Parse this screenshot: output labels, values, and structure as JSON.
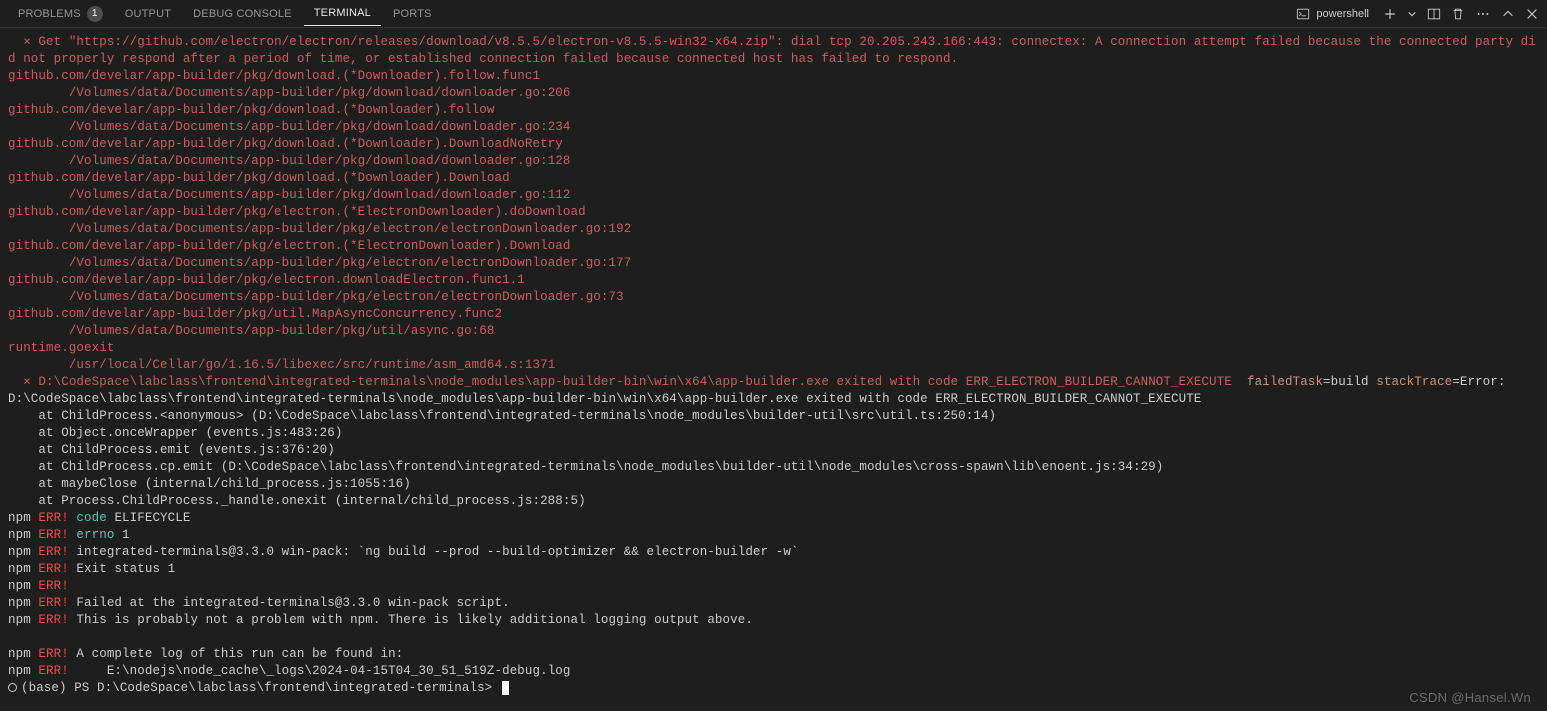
{
  "panel": {
    "tabs": {
      "problems": "PROBLEMS",
      "problemsCount": "1",
      "output": "OUTPUT",
      "debugConsole": "DEBUG CONSOLE",
      "terminal": "TERMINAL",
      "ports": "PORTS"
    },
    "shell": "powershell"
  },
  "term": {
    "errHead": "  ⨯ Get \"https://github.com/electron/electron/releases/download/v8.5.5/electron-v8.5.5-win32-x64.zip\": dial tcp 20.205.243.166:443: connectex: A connection attempt failed because the connected party did not properly respond after a period of time, or established connection failed because connected host has failed to respond.",
    "stackRed": [
      "github.com/develar/app-builder/pkg/download.(*Downloader).follow.func1",
      "        /Volumes/data/Documents/app-builder/pkg/download/downloader.go:206",
      "github.com/develar/app-builder/pkg/download.(*Downloader).follow",
      "        /Volumes/data/Documents/app-builder/pkg/download/downloader.go:234",
      "github.com/develar/app-builder/pkg/download.(*Downloader).DownloadNoRetry",
      "        /Volumes/data/Documents/app-builder/pkg/download/downloader.go:128",
      "github.com/develar/app-builder/pkg/download.(*Downloader).Download",
      "        /Volumes/data/Documents/app-builder/pkg/download/downloader.go:112",
      "github.com/develar/app-builder/pkg/electron.(*ElectronDownloader).doDownload",
      "        /Volumes/data/Documents/app-builder/pkg/electron/electronDownloader.go:192",
      "github.com/develar/app-builder/pkg/electron.(*ElectronDownloader).Download",
      "        /Volumes/data/Documents/app-builder/pkg/electron/electronDownloader.go:177",
      "github.com/develar/app-builder/pkg/electron.downloadElectron.func1.1",
      "        /Volumes/data/Documents/app-builder/pkg/electron/electronDownloader.go:73",
      "github.com/develar/app-builder/pkg/util.MapAsyncConcurrency.func2",
      "        /Volumes/data/Documents/app-builder/pkg/util/async.go:68",
      "runtime.goexit",
      "        /usr/local/Cellar/go/1.16.5/libexec/src/runtime/asm_amd64.s:1371"
    ],
    "exeErr": {
      "pre": "  ⨯ D:\\CodeSpace\\labclass\\frontend\\integrated-terminals\\node_modules\\app-builder-bin\\win\\x64\\app-builder.exe exited with code ERR_ELECTRON_BUILDER_CANNOT_EXECUTE  ",
      "failedTaskKey": "failedTask",
      "failedTaskVal": "=build ",
      "stackTraceKey": "stackTrace",
      "stackTraceRest": "=Error: D:\\CodeSpace\\labclass\\frontend\\integrated-terminals\\node_modules\\app-builder-bin\\win\\x64\\app-builder.exe exited with code ERR_ELECTRON_BUILDER_CANNOT_EXECUTE"
    },
    "jsStack": [
      "    at ChildProcess.<anonymous> (D:\\CodeSpace\\labclass\\frontend\\integrated-terminals\\node_modules\\builder-util\\src\\util.ts:250:14)",
      "    at Object.onceWrapper (events.js:483:26)",
      "    at ChildProcess.emit (events.js:376:20)",
      "    at ChildProcess.cp.emit (D:\\CodeSpace\\labclass\\frontend\\integrated-terminals\\node_modules\\builder-util\\node_modules\\cross-spawn\\lib\\enoent.js:34:29)",
      "    at maybeClose (internal/child_process.js:1055:16)",
      "    at Process.ChildProcess._handle.onexit (internal/child_process.js:288:5)"
    ],
    "npm": {
      "npmLabel": "npm",
      "errLabel": " ERR!",
      "codeKey": " code",
      "codeVal": " ELIFECYCLE",
      "errnoKey": " errno",
      "errnoVal": " 1",
      "line3": " integrated-terminals@3.3.0 win-pack: `ng build --prod --build-optimizer && electron-builder -w`",
      "line4": " Exit status 1",
      "line6": " Failed at the integrated-terminals@3.3.0 win-pack script.",
      "line7": " This is probably not a problem with npm. There is likely additional logging output above.",
      "line9": " A complete log of this run can be found in:",
      "line10": "     E:\\nodejs\\node_cache\\_logs\\2024-04-15T04_30_51_519Z-debug.log"
    },
    "prompt": "(base) PS D:\\CodeSpace\\labclass\\frontend\\integrated-terminals> "
  },
  "watermark": "CSDN @Hansel.Wn"
}
